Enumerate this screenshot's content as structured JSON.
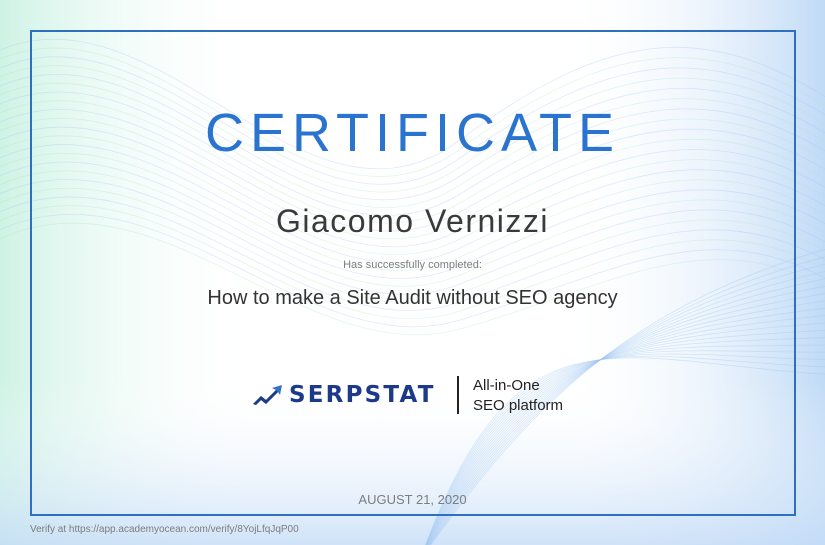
{
  "certificate": {
    "title": "CERTIFICATE",
    "recipient_name": "Giacomo Vernizzi",
    "completed_label": "Has successfully completed:",
    "course_title": "How to make a Site Audit without SEO agency",
    "date": "AUGUST 21, 2020",
    "verify_text": "Verify at https://app.academyocean.com/verify/8YojLfqJqP00"
  },
  "logo": {
    "brand": "SERPSTAT",
    "tagline_line1": "All-in-One",
    "tagline_line2": "SEO platform"
  },
  "colors": {
    "accent": "#2a74d0",
    "frame": "#2f6fc0",
    "brand": "#1d3a8a",
    "wave_green": "#a8e6cf",
    "wave_blue": "#9ec5f0"
  }
}
